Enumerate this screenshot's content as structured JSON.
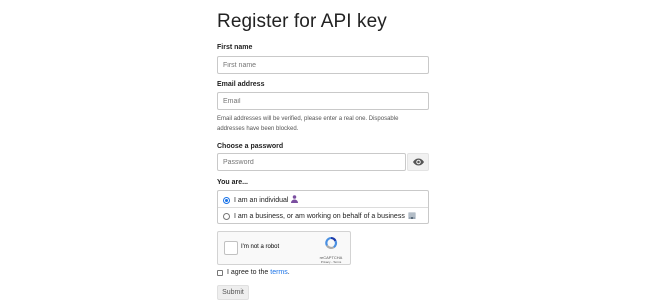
{
  "title": "Register for API key",
  "first_name": {
    "label": "First name",
    "placeholder": "First name",
    "value": ""
  },
  "email": {
    "label": "Email address",
    "placeholder": "Email",
    "value": "",
    "help_line1": "Email addresses will be verified, please enter a real one. Disposable",
    "help_line2": "addresses have been blocked."
  },
  "password": {
    "label": "Choose a password",
    "placeholder": "Password",
    "value": "",
    "toggle_icon": "eye-icon"
  },
  "you_are": {
    "label": "You are...",
    "options": [
      {
        "label": "I am an individual",
        "selected": true,
        "icon": "person-icon"
      },
      {
        "label": "I am a business, or am working on behalf of a business",
        "selected": false,
        "icon": "building-icon"
      }
    ]
  },
  "captcha": {
    "label": "I'm not a robot",
    "brand": "reCAPTCHA",
    "links": "Privacy - Terms",
    "checked": false
  },
  "agree": {
    "prefix": "I agree to the",
    "link_text": "terms",
    "suffix": ".",
    "checked": false
  },
  "submit": {
    "label": "Submit"
  },
  "colors": {
    "accent": "#1a73e8",
    "border": "#c9c9c9",
    "text": "#222222"
  }
}
